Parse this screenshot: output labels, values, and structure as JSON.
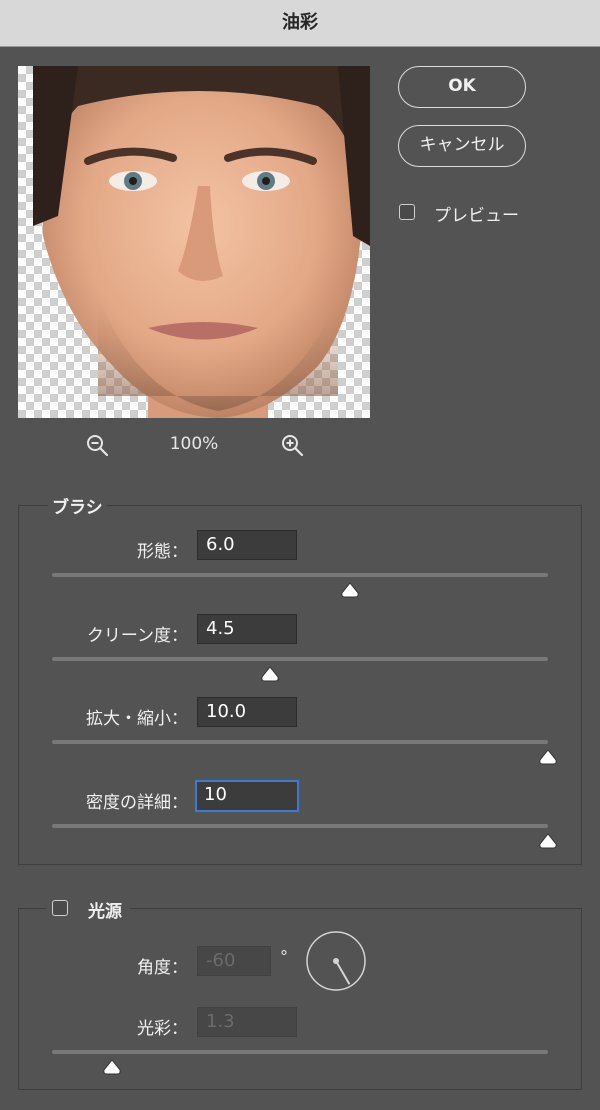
{
  "window": {
    "title": "油彩"
  },
  "buttons": {
    "ok": "OK",
    "cancel": "キャンセル"
  },
  "preview_toggle": {
    "label": "プレビュー",
    "checked": false
  },
  "zoom": {
    "level": "100%"
  },
  "brush": {
    "title": "ブラシ",
    "fields": [
      {
        "label": "形態：",
        "value": "6.0",
        "fraction": 0.6
      },
      {
        "label": "クリーン度：",
        "value": "4.5",
        "fraction": 0.44
      },
      {
        "label": "拡大・縮小：",
        "value": "10.0",
        "fraction": 1.0
      },
      {
        "label": "密度の詳細：",
        "value": "10",
        "fraction": 1.0
      }
    ]
  },
  "lighting": {
    "title": "光源",
    "enabled": false,
    "angle_label": "角度：",
    "angle_value": "-60",
    "angle_unit": "°",
    "shine_label": "光彩：",
    "shine_value": "1.3",
    "shine_fraction": 0.12
  }
}
